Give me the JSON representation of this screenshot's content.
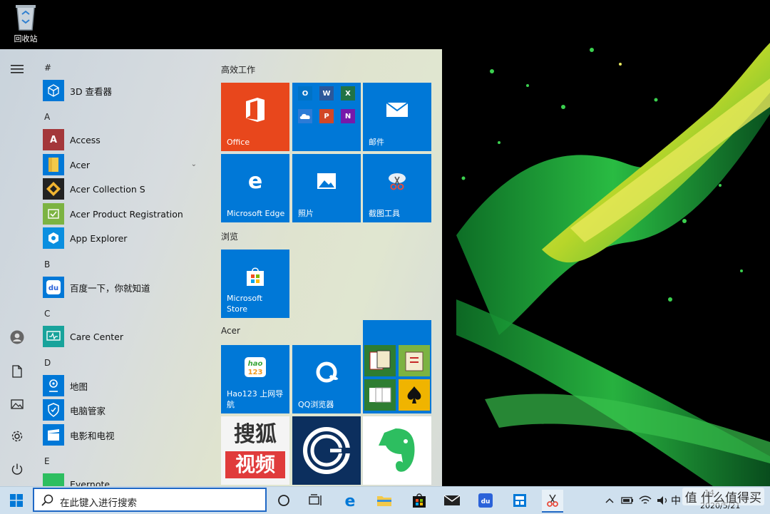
{
  "desktop": {
    "recycle_bin_label": "回收站"
  },
  "start": {
    "menu_icon": "hamburger-icon",
    "letters": {
      "hash": "#",
      "a": "A",
      "b": "B",
      "c": "C",
      "d": "D",
      "e": "E"
    },
    "apps": {
      "viewer3d": "3D 查看器",
      "access": "Access",
      "acer": "Acer",
      "acer_collection": "Acer Collection S",
      "acer_product_reg": "Acer Product Registration",
      "app_explorer": "App Explorer",
      "baidu": "百度一下，你就知道",
      "care_center": "Care Center",
      "maps": "地图",
      "pc_manager": "电脑管家",
      "movies": "电影和电视",
      "evernote": "Evernote"
    },
    "groups": {
      "productivity": "高效工作",
      "browse": "浏览",
      "acer": "Acer"
    },
    "tiles": {
      "office": "Office",
      "mail": "邮件",
      "edge": "Microsoft Edge",
      "photos": "照片",
      "snip": "截图工具",
      "store": "Microsoft Store",
      "hao123": "Hao123 上网导航",
      "qq_browser": "QQ浏览器",
      "sohu_line1": "搜狐",
      "sohu_line2": "视频",
      "hao_badge": "hao",
      "hao_num": "123"
    },
    "office_minis": [
      "O",
      "W",
      "X",
      "P",
      "N"
    ]
  },
  "taskbar": {
    "search_placeholder": "在此键入进行搜索",
    "ime": "中",
    "date": "2020/5/21",
    "time_partial": "14"
  },
  "watermark": "值 什么值得买",
  "colors": {
    "tile_blue": "#0078d7",
    "office_orange": "#e8471c",
    "taskbar_accent": "#1f68c5"
  }
}
